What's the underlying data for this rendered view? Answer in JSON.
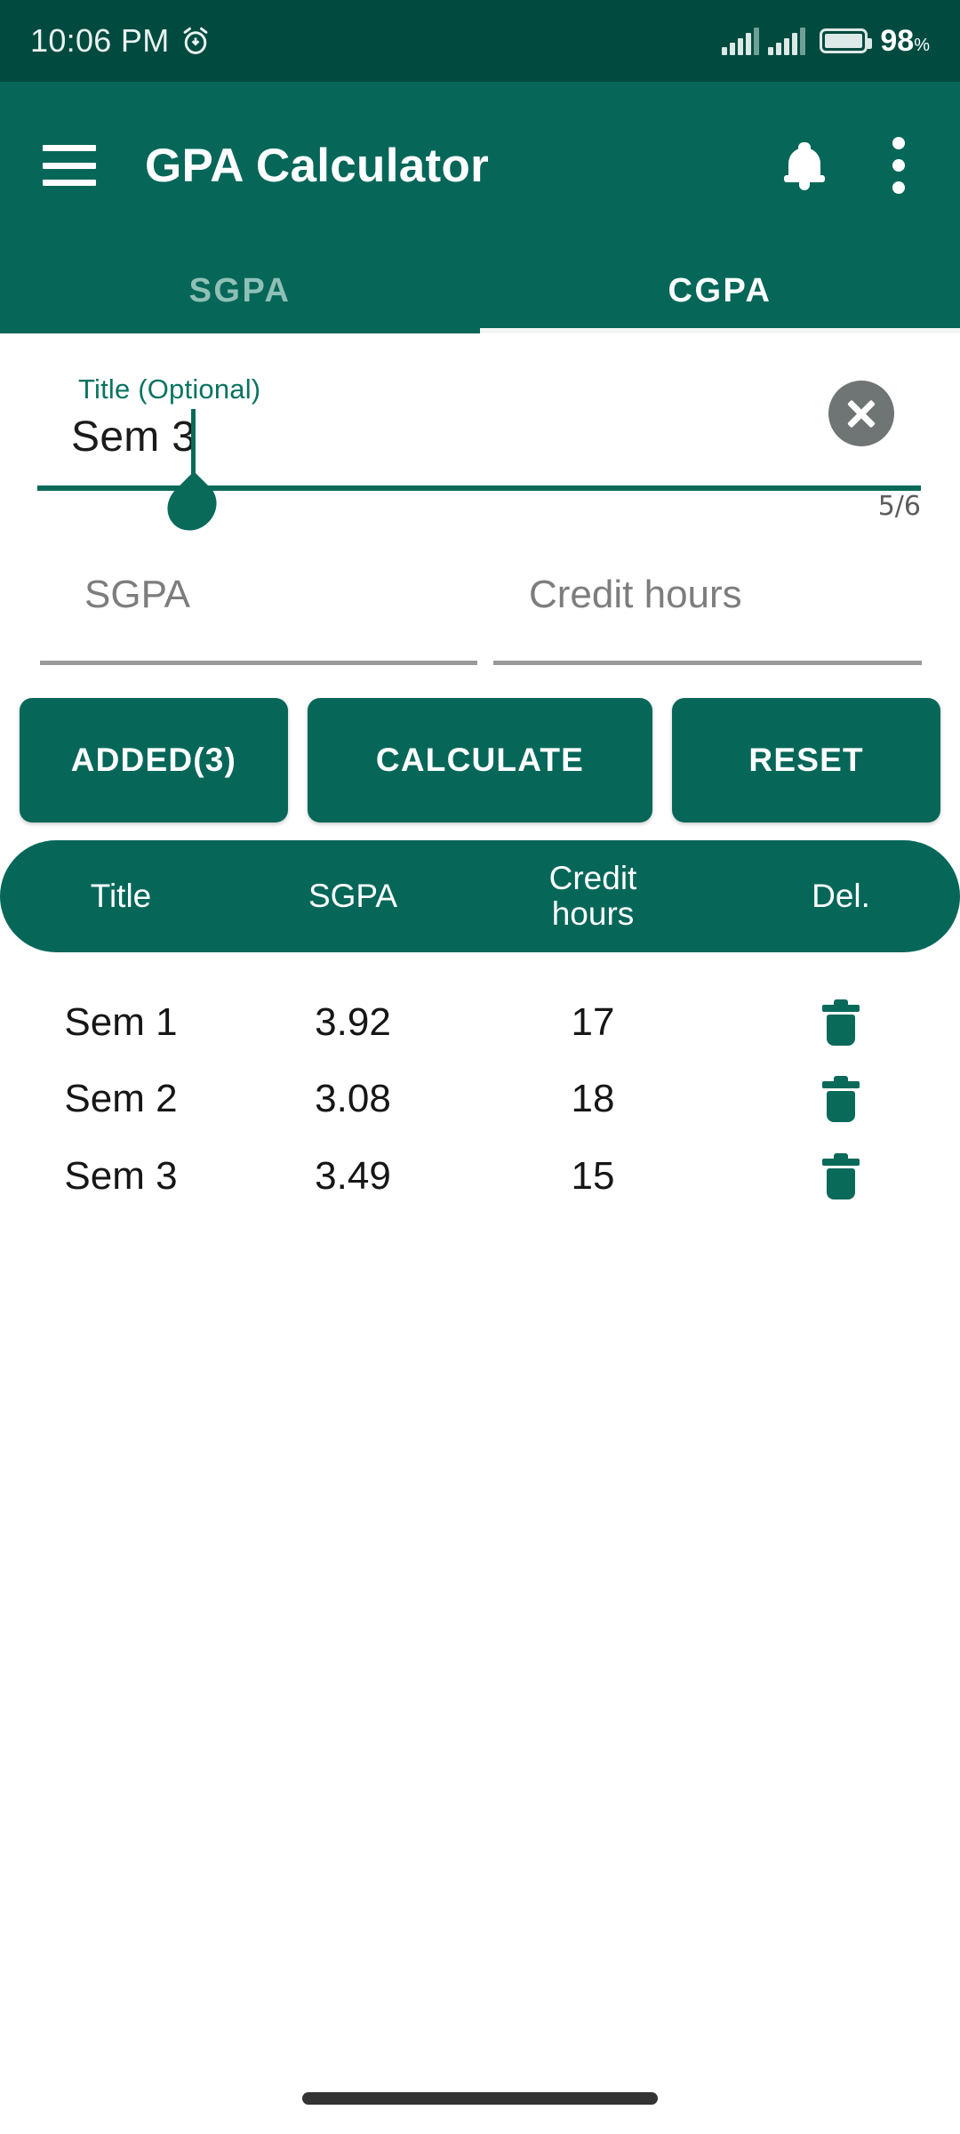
{
  "status_bar": {
    "time": "10:06 PM",
    "alarm_icon": "alarm-clock-icon",
    "signal_icon": "signal-bars-icon",
    "battery_icon": "battery-icon",
    "battery_percent": "98",
    "percent_symbol": "%"
  },
  "appbar": {
    "menu_icon": "hamburger-menu-icon",
    "title": "GPA Calculator",
    "bell_icon": "notification-bell-icon",
    "overflow_icon": "more-vertical-icon",
    "background_color": "#066759"
  },
  "tabs": [
    {
      "label": "SGPA",
      "active": false
    },
    {
      "label": "CGPA",
      "active": true
    }
  ],
  "title_field": {
    "label": "Title (Optional)",
    "value": "Sem 3",
    "clear_icon": "close-circle-icon",
    "counter": "5/6",
    "accent_color": "#0a6a5a"
  },
  "entry_inputs": [
    {
      "placeholder": "SGPA",
      "value": ""
    },
    {
      "placeholder": "Credit hours",
      "value": ""
    }
  ],
  "buttons": {
    "added": "ADDED(3)",
    "calculate": "CALCULATE",
    "reset": "RESET"
  },
  "table": {
    "headers": {
      "title": "Title",
      "sgpa": "SGPA",
      "credit_line1": "Credit",
      "credit_line2": "hours",
      "delete": "Del."
    },
    "rows": [
      {
        "title": "Sem 1",
        "sgpa": "3.92",
        "credit_hours": "17",
        "delete_icon": "trash-icon"
      },
      {
        "title": "Sem 2",
        "sgpa": "3.08",
        "credit_hours": "18",
        "delete_icon": "trash-icon"
      },
      {
        "title": "Sem 3",
        "sgpa": "3.49",
        "credit_hours": "15",
        "delete_icon": "trash-icon"
      }
    ]
  },
  "navigation": {
    "pill_icon": "gesture-nav-pill"
  }
}
